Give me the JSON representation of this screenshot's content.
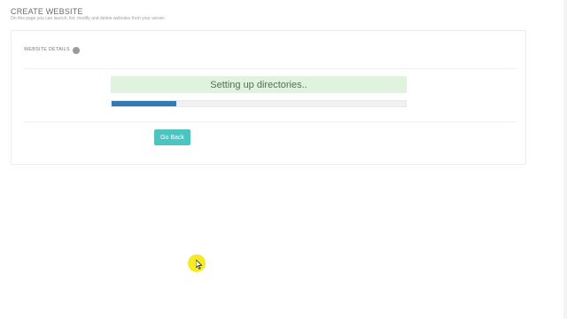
{
  "header": {
    "title": "CREATE WEBSITE",
    "subtitle": "On this page you can launch, list, modify and delete websites from your server."
  },
  "card": {
    "heading": "WEBSITE DETAILS",
    "status_text": "Setting up directories..",
    "progress_percent": 22,
    "go_back_label": "Go Back"
  },
  "colors": {
    "status_background": "#dff3df",
    "progress_fill": "#337ab7",
    "button": "#4ec4c0",
    "cursor_highlight": "#f6e81a"
  },
  "icons": {
    "info": "info-dot-icon",
    "cursor": "mouse-cursor-icon"
  }
}
